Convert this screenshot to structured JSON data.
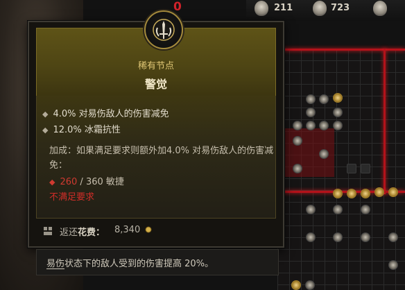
{
  "top_bar": {
    "stats": [
      {
        "icon": "skull-icon",
        "value": "211"
      },
      {
        "icon": "helm-icon",
        "value": "723"
      },
      {
        "icon": "demon-icon",
        "value": ""
      }
    ],
    "partial_mark": "0"
  },
  "tooltip": {
    "crest_icon": "sword-crest-icon",
    "rarity": "稀有节点",
    "title": "警觉",
    "bullets": [
      "4.0% 对易伤敌人的伤害减免",
      "12.0% 冰霜抗性"
    ],
    "bonus_text": "加成：如果满足要求则额外加4.0% 对易伤敌人的伤害减免：",
    "requirement": {
      "current": "260",
      "separator": " / ",
      "required": "360",
      "stat": "敏捷"
    },
    "requirement_warning": "不满足要求",
    "footer": {
      "label_prefix": "返还",
      "label_bold": "花费：",
      "value": "8,340"
    }
  },
  "description": {
    "term": "易伤",
    "text": "状态下的敌人受到的伤害提高 20%。"
  },
  "colors": {
    "gold_text": "#e0c775",
    "warning_red": "#cf2d28",
    "header_olive": "#5e5317"
  }
}
